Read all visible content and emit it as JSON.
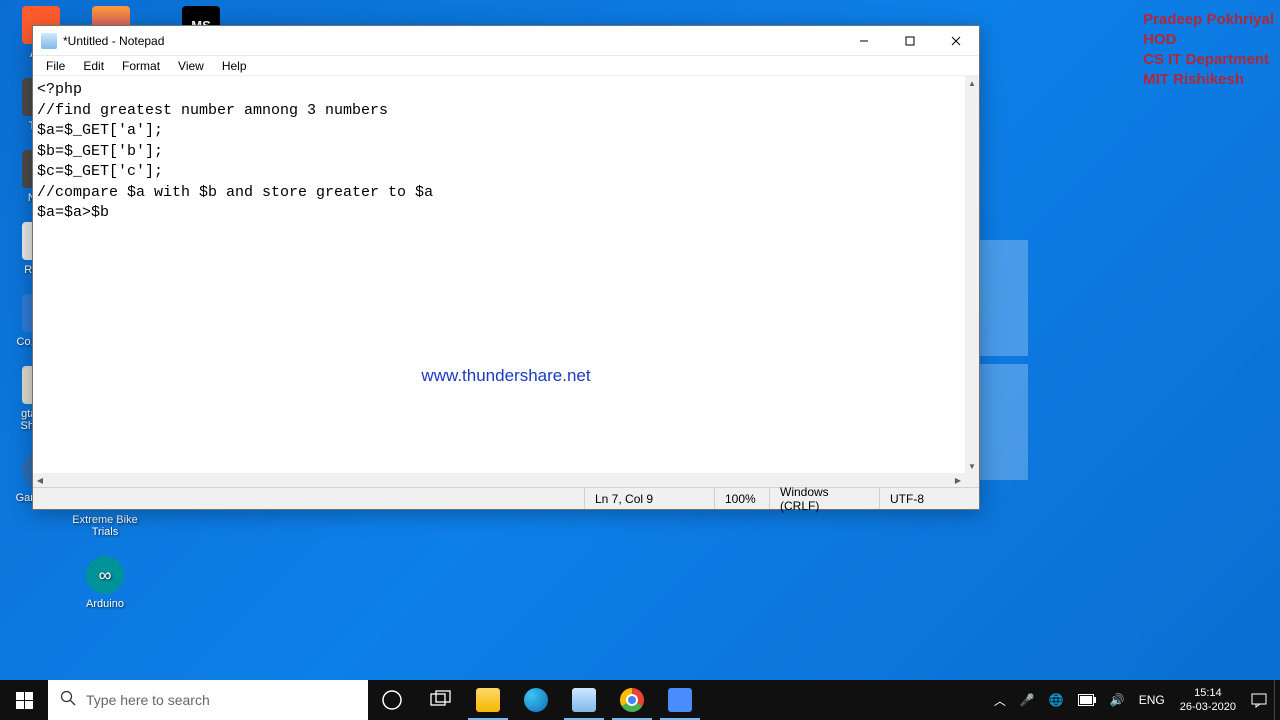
{
  "watermark": {
    "line1": "Pradeep Pokhriyal",
    "line2": "HOD",
    "line3": "CS IT Department",
    "line4": "MIT Rishikesh"
  },
  "desktop": {
    "col1": [
      {
        "label": "As..."
      },
      {
        "label": "Thi..."
      },
      {
        "label": "Net..."
      },
      {
        "label": "Recy..."
      },
      {
        "label": "Co... Pa..."
      },
      {
        "label": "gta_sa - Shortcut"
      },
      {
        "label": "Gameloop"
      }
    ],
    "col2": [
      {
        "label": "Extreme Bike Trials"
      },
      {
        "label": "Arduino"
      }
    ],
    "top_icons": [
      {
        "label": ""
      },
      {
        "label": "MS"
      }
    ]
  },
  "notepad": {
    "title": "*Untitled - Notepad",
    "menu": [
      "File",
      "Edit",
      "Format",
      "View",
      "Help"
    ],
    "content": "<?php\n//find greatest number amnong 3 numbers\n$a=$_GET['a'];\n$b=$_GET['b'];\n$c=$_GET['c'];\n//compare $a with $b and store greater to $a\n$a=$a>$b",
    "overlay_url": "www.thundershare.net",
    "status": {
      "pos": "Ln 7, Col 9",
      "zoom": "100%",
      "lineend": "Windows (CRLF)",
      "encoding": "UTF-8"
    }
  },
  "taskbar": {
    "search_placeholder": "Type here to search",
    "tray": {
      "lang": "ENG",
      "time": "15:14",
      "date": "26-03-2020"
    }
  }
}
